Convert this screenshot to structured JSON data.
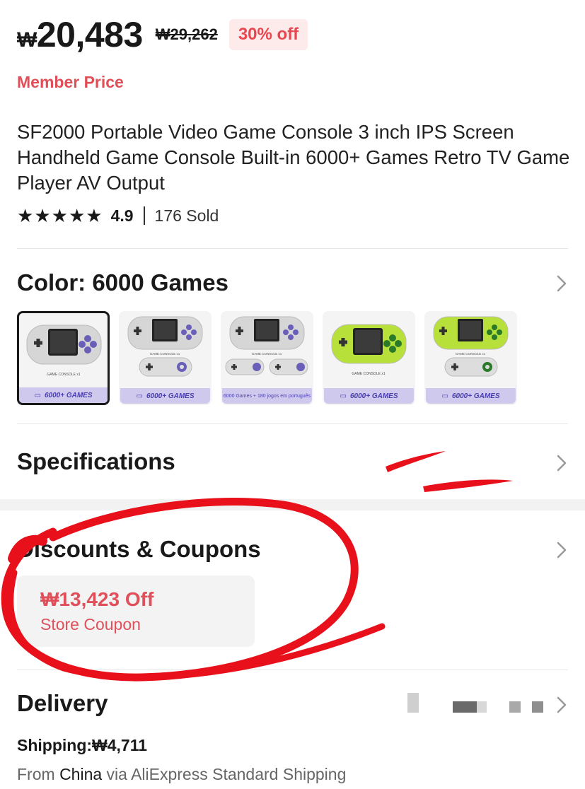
{
  "price": {
    "currency": "₩",
    "current": "20,483",
    "original": "₩29,262",
    "discount": "30% off"
  },
  "member_price": "Member Price",
  "product": {
    "title": "SF2000 Portable Video Game Console 3 inch IPS Screen Handheld Game Console Built-in 6000+ Games Retro TV Game Player AV Output",
    "rating": "4.9",
    "sold": "176 Sold"
  },
  "color": {
    "heading": "Color: 6000 Games",
    "variants": [
      {
        "caption": "6000+ GAMES",
        "inner": "GAME CONSOLE x1",
        "selected": true,
        "shell": "#d6d6d6",
        "accent": "#6a5fb8"
      },
      {
        "caption": "6000+ GAMES",
        "inner": "GAME CONSOLE x1",
        "selected": false,
        "shell": "#d6d6d6",
        "accent": "#6a5fb8"
      },
      {
        "caption": "6000 Games + 180 jogos em português",
        "inner": "GAME CONSOLE x1",
        "selected": false,
        "shell": "#d6d6d6",
        "accent": "#6a5fb8"
      },
      {
        "caption": "6000+ GAMES",
        "inner": "GAME CONSOLE x1",
        "selected": false,
        "shell": "#b8e03a",
        "accent": "#2a7a2a"
      },
      {
        "caption": "6000+ GAMES",
        "inner": "GAME CONSOLE x1",
        "selected": false,
        "shell": "#b8e03a",
        "accent": "#2a7a2a"
      }
    ]
  },
  "specifications": {
    "heading": "Specifications"
  },
  "discounts": {
    "heading": "Discounts & Coupons",
    "coupon_amount": "₩13,423 Off",
    "coupon_label": "Store Coupon"
  },
  "delivery": {
    "heading": "Delivery",
    "shipping": "Shipping:₩4,711",
    "from_prefix": "From ",
    "from_country": "China",
    "from_suffix": " via AliExpress Standard Shipping"
  },
  "colors": {
    "accent_red": "#e04e57",
    "badge_bg": "#fdeaea",
    "annotation_red": "#e8101a",
    "caption_bg": "#cfc9ee"
  }
}
